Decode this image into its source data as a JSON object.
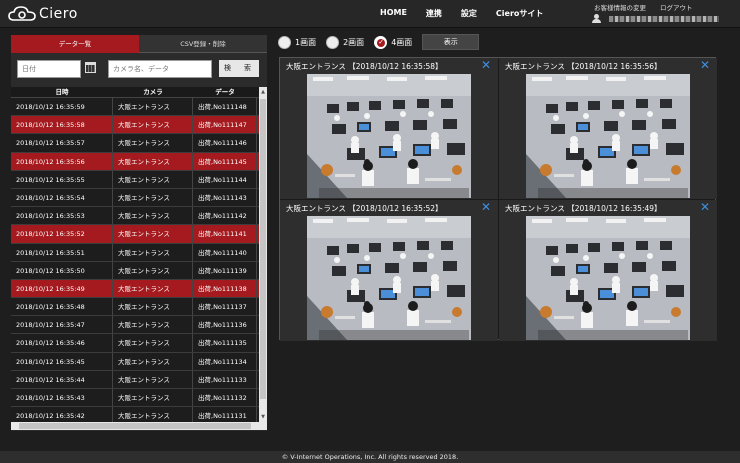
{
  "header": {
    "logo_text": "Ciero",
    "nav": [
      "HOME",
      "連携",
      "設定",
      "Cieroサイト"
    ],
    "account_change": "お客様情報の変更",
    "logout": "ログアウト"
  },
  "left": {
    "tab_active": "データ一覧",
    "tab_inactive": "CSV登録・削除",
    "date_placeholder": "日付",
    "keyword_placeholder": "カメラ名、データ",
    "search_button": "検　索",
    "columns": [
      "日時",
      "カメラ",
      "データ"
    ],
    "rows": [
      {
        "time": "2018/10/12 16:35:59",
        "camera": "大阪エントランス",
        "data": "出荷,No111148",
        "highlight": false
      },
      {
        "time": "2018/10/12 16:35:58",
        "camera": "大阪エントランス",
        "data": "出荷,No111147",
        "highlight": true
      },
      {
        "time": "2018/10/12 16:35:57",
        "camera": "大阪エントランス",
        "data": "出荷,No111146",
        "highlight": false
      },
      {
        "time": "2018/10/12 16:35:56",
        "camera": "大阪エントランス",
        "data": "出荷,No111145",
        "highlight": true
      },
      {
        "time": "2018/10/12 16:35:55",
        "camera": "大阪エントランス",
        "data": "出荷,No111144",
        "highlight": false
      },
      {
        "time": "2018/10/12 16:35:54",
        "camera": "大阪エントランス",
        "data": "出荷,No111143",
        "highlight": false
      },
      {
        "time": "2018/10/12 16:35:53",
        "camera": "大阪エントランス",
        "data": "出荷,No111142",
        "highlight": false
      },
      {
        "time": "2018/10/12 16:35:52",
        "camera": "大阪エントランス",
        "data": "出荷,No111141",
        "highlight": true
      },
      {
        "time": "2018/10/12 16:35:51",
        "camera": "大阪エントランス",
        "data": "出荷,No111140",
        "highlight": false
      },
      {
        "time": "2018/10/12 16:35:50",
        "camera": "大阪エントランス",
        "data": "出荷,No111139",
        "highlight": false
      },
      {
        "time": "2018/10/12 16:35:49",
        "camera": "大阪エントランス",
        "data": "出荷,No111138",
        "highlight": true
      },
      {
        "time": "2018/10/12 16:35:48",
        "camera": "大阪エントランス",
        "data": "出荷,No111137",
        "highlight": false
      },
      {
        "time": "2018/10/12 16:35:47",
        "camera": "大阪エントランス",
        "data": "出荷,No111136",
        "highlight": false
      },
      {
        "time": "2018/10/12 16:35:46",
        "camera": "大阪エントランス",
        "data": "出荷,No111135",
        "highlight": false
      },
      {
        "time": "2018/10/12 16:35:45",
        "camera": "大阪エントランス",
        "data": "出荷,No111134",
        "highlight": false
      },
      {
        "time": "2018/10/12 16:35:44",
        "camera": "大阪エントランス",
        "data": "出荷,No111133",
        "highlight": false
      },
      {
        "time": "2018/10/12 16:35:43",
        "camera": "大阪エントランス",
        "data": "出荷,No111132",
        "highlight": false
      },
      {
        "time": "2018/10/12 16:35:42",
        "camera": "大阪エントランス",
        "data": "出荷,No111131",
        "highlight": false
      }
    ]
  },
  "viewer": {
    "modes": [
      "1画面",
      "2画面",
      "4画面"
    ],
    "selected_mode": "4画面",
    "show_button": "表示",
    "cameras": [
      {
        "title": "大阪エントランス 【2018/10/12 16:35:58】"
      },
      {
        "title": "大阪エントランス 【2018/10/12 16:35:56】"
      },
      {
        "title": "大阪エントランス 【2018/10/12 16:35:52】"
      },
      {
        "title": "大阪エントランス 【2018/10/12 16:35:49】"
      }
    ]
  },
  "footer": "© V-Internet Operations, Inc. All rights reserved 2018.",
  "colors": {
    "accent": "#a51a1e",
    "close_icon": "#3d8fe0",
    "background": "#1e1e1e"
  }
}
